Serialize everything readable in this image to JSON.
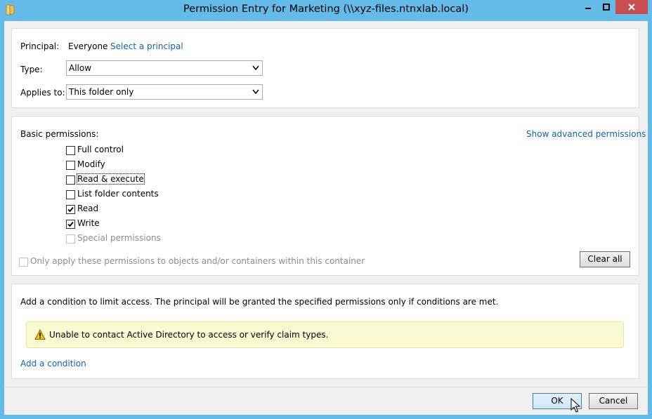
{
  "window": {
    "title": "Permission Entry for Marketing (\\\\xyz-files.ntnxlab.local)"
  },
  "principal": {
    "label": "Principal:",
    "value": "Everyone",
    "select_link": "Select a principal"
  },
  "type": {
    "label": "Type:",
    "value": "Allow"
  },
  "applies_to": {
    "label": "Applies to:",
    "value": "This folder only"
  },
  "permissions": {
    "label": "Basic permissions:",
    "advanced_link": "Show advanced permissions",
    "items": [
      {
        "label": "Full control",
        "checked": false,
        "disabled": false
      },
      {
        "label": "Modify",
        "checked": false,
        "disabled": false
      },
      {
        "label": "Read & execute",
        "checked": false,
        "disabled": false
      },
      {
        "label": "List folder contents",
        "checked": false,
        "disabled": false
      },
      {
        "label": "Read",
        "checked": true,
        "disabled": false
      },
      {
        "label": "Write",
        "checked": true,
        "disabled": false
      },
      {
        "label": "Special permissions",
        "checked": false,
        "disabled": true
      }
    ],
    "only_apply_label": "Only apply these permissions to objects and/or containers within this container",
    "clear_all": "Clear all"
  },
  "condition": {
    "description": "Add a condition to limit access. The principal will be granted the specified permissions only if conditions are met.",
    "warning": "Unable to contact Active Directory to access or verify claim types.",
    "add_link": "Add a condition"
  },
  "footer": {
    "ok": "OK",
    "cancel": "Cancel"
  },
  "colors": {
    "titlebar": "#65bbe8",
    "close": "#c74f4f",
    "link": "#0f64b4",
    "warning_bg": "#fafad2"
  }
}
